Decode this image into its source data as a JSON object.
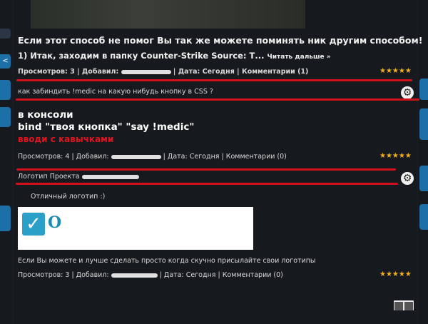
{
  "post1": {
    "heading": "Если этот способ не помог Вы так же можете поминять ник другим способом!",
    "subheading": "1) Итак, заходим в папку Counter-Strike Source: Т...",
    "read_more": "Читать дальше »",
    "meta_views": "Просмотров: 3 | Добавил: ",
    "meta_date": " | Дата: ",
    "meta_date_val": "Сегодня",
    "meta_comments": " | Комментарии (1)",
    "stars": "★★★★★"
  },
  "post2": {
    "question": "как забиндить !medic на какую нибудь кнопку в CSS ?",
    "answer_line1": "в консоли",
    "answer_line2": "bind \"твоя кнопка\" \"say !medic\"",
    "answer_line3": "вводи с кавычками",
    "meta": "Просмотров: 4 | Добавил: ",
    "meta_rest": " | Дата: Сегодня | Комментарии (0)",
    "stars": "★★★★★"
  },
  "post3": {
    "title": "Логотип Проекта ",
    "comment": "Отличный логотип  :)",
    "logo_letter": "О",
    "footer_text": "Если Вы можете и лучше сделать просто когда скучно присылайте свои логотипы",
    "meta": "Просмотров: 3 | Добавил: ",
    "meta_rest": " | Дата: Сегодня | Комментарии (0)",
    "stars": "★★★★★"
  },
  "icons": {
    "gear": "⚙",
    "check": "✓",
    "left_arrow": "<"
  },
  "colors": {
    "accent_blue": "#1d6fa8",
    "red_underline": "#d0111b",
    "star": "#f2b01e"
  }
}
